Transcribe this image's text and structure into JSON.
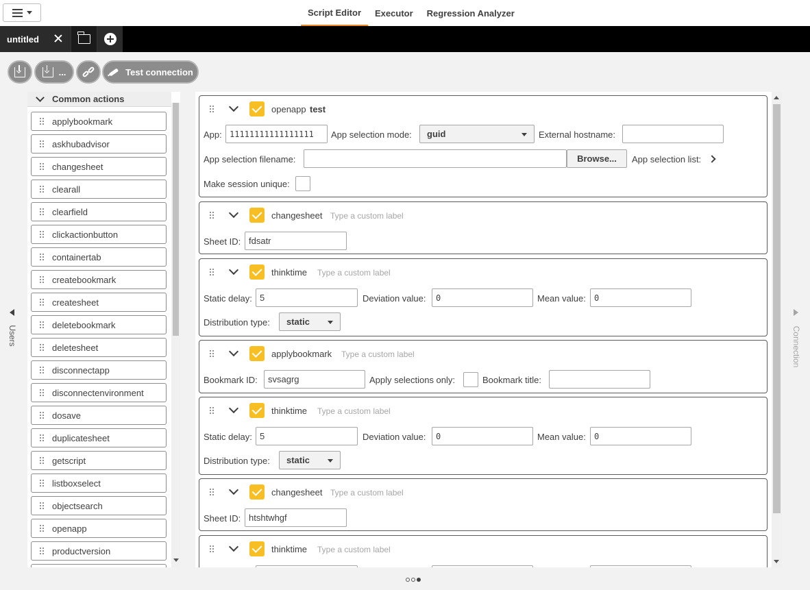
{
  "nav": {
    "tabs": [
      "Script Editor",
      "Executor",
      "Regression Analyzer"
    ]
  },
  "doc_tab": {
    "title": "untitled"
  },
  "toolbar": {
    "save_more": "...",
    "test_connection": "Test connection"
  },
  "side_tabs": {
    "users": "Users",
    "connection": "Connection"
  },
  "actions": {
    "header": "Common actions",
    "items": [
      "applybookmark",
      "askhubadvisor",
      "changesheet",
      "clearall",
      "clearfield",
      "clickactionbutton",
      "containertab",
      "createbookmark",
      "createsheet",
      "deletebookmark",
      "deletesheet",
      "disconnectapp",
      "disconnectenvironment",
      "dosave",
      "duplicatesheet",
      "getscript",
      "listboxselect",
      "objectsearch",
      "openapp",
      "productversion"
    ]
  },
  "cards": {
    "openapp": {
      "type": "openapp",
      "label": "test",
      "app_label": "App:",
      "app_value": "11111111111111111",
      "mode_label": "App selection mode:",
      "mode_value": "guid",
      "ext_host_label": "External hostname:",
      "ext_host_value": "",
      "filename_label": "App selection filename:",
      "filename_value": "",
      "browse": "Browse...",
      "list_label": "App selection list:",
      "unique_label": "Make session unique:"
    },
    "changesheet1": {
      "type": "changesheet",
      "placeholder": "Type a custom label",
      "sheet_label": "Sheet ID:",
      "sheet_value": "fdsatr"
    },
    "thinktime1": {
      "type": "thinktime",
      "placeholder": "Type a custom label",
      "static_label": "Static delay:",
      "static_value": "5",
      "dev_label": "Deviation value:",
      "dev_value": "0",
      "mean_label": "Mean value:",
      "mean_value": "0",
      "dist_label": "Distribution type:",
      "dist_value": "static"
    },
    "applybookmark": {
      "type": "applybookmark",
      "placeholder": "Type a custom label",
      "id_label": "Bookmark ID:",
      "id_value": "svsagrg",
      "sel_only_label": "Apply selections only:",
      "title_label": "Bookmark title:",
      "title_value": ""
    },
    "thinktime2": {
      "type": "thinktime",
      "placeholder": "Type a custom label",
      "static_label": "Static delay:",
      "static_value": "5",
      "dev_label": "Deviation value:",
      "dev_value": "0",
      "mean_label": "Mean value:",
      "mean_value": "0",
      "dist_label": "Distribution type:",
      "dist_value": "static"
    },
    "changesheet2": {
      "type": "changesheet",
      "placeholder": "Type a custom label",
      "sheet_label": "Sheet ID:",
      "sheet_value": "htshtwhgf"
    },
    "thinktime3": {
      "type": "thinktime",
      "placeholder": "Type a custom label"
    }
  },
  "colors": {
    "accent": "#ea8c2c",
    "checkbox": "#f8bf24",
    "toolbar_button": "#8c8c8c"
  },
  "icons": [
    "menu-icon",
    "close-icon",
    "folder-icon",
    "plus-circle-icon",
    "download-icon",
    "link-icon",
    "plug-icon",
    "grip-icon",
    "chevron-down-icon",
    "chevron-right-icon",
    "check-icon"
  ]
}
